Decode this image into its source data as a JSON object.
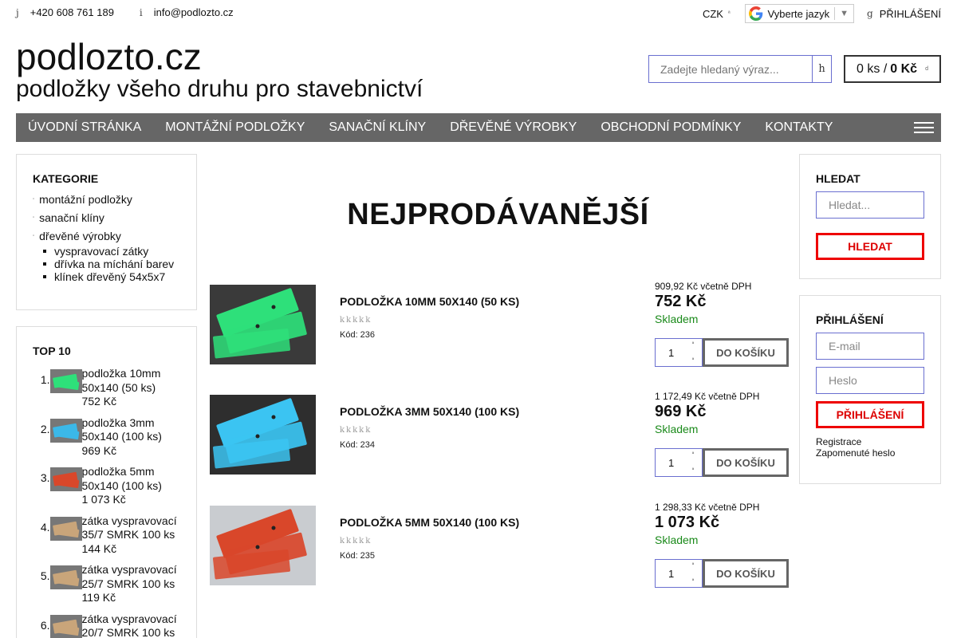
{
  "topbar": {
    "phone_icon": "j",
    "phone": "+420 608 761 189",
    "mail_icon": "i",
    "email": "info@podlozto.cz",
    "currency": "CZK",
    "currency_icon": "ª",
    "language_label": "Vyberte jazyk",
    "language_arrow": "▼",
    "login_icon": "g",
    "login_label": "PŘIHLÁŠENÍ"
  },
  "header": {
    "title": "podlozto.cz",
    "subtitle": "podložky všeho druhu pro stavebnictví",
    "search_placeholder": "Zadejte hledaný výraz...",
    "search_button_icon": "h",
    "cart_count": "0 ks /",
    "cart_total": "0 Kč",
    "cart_icon": "d"
  },
  "nav": {
    "items": [
      "ÚVODNÍ STRÁNKA",
      "MONTÁŽNÍ PODLOŽKY",
      "SANAČNÍ KLÍNY",
      "DŘEVĚNÉ VÝROBKY",
      "OBCHODNÍ PODMÍNKY",
      "KONTAKTY"
    ]
  },
  "categories": {
    "title": "KATEGORIE",
    "bullet": "▫",
    "items": [
      "montážní podložky",
      "sanační klíny",
      "dřevěné výrobky"
    ],
    "subitems": [
      "vyspravovací zátky",
      "dřívka na míchání barev",
      "klínek dřevěný 54x5x7"
    ]
  },
  "top10": {
    "title": "TOP 10",
    "items": [
      {
        "num": "1.",
        "text": "podložka 10mm 50x140 (50 ks)",
        "price": "752 Kč",
        "color": "#2ee07a"
      },
      {
        "num": "2.",
        "text": "podložka 3mm 50x140 (100 ks)",
        "price": "969 Kč",
        "color": "#3bb8e8"
      },
      {
        "num": "3.",
        "text": "podložka 5mm 50x140 (100 ks)",
        "price": "1 073 Kč",
        "color": "#d9472a"
      },
      {
        "num": "4.",
        "text": "zátka vyspravovací 35/7 SMRK 100 ks",
        "price": "144 Kč",
        "color": "#c9a57a"
      },
      {
        "num": "5.",
        "text": "zátka vyspravovací 25/7 SMRK 100 ks",
        "price": "119 Kč",
        "color": "#c9a57a"
      },
      {
        "num": "6.",
        "text": "zátka vyspravovací 20/7 SMRK 100 ks",
        "price": "",
        "color": "#c9a57a"
      }
    ]
  },
  "main": {
    "heading": "NEJPRODÁVANĚJŠÍ",
    "products": [
      {
        "name": "PODLOŽKA 10MM 50X140 (50 KS)",
        "stars": "kkkkk",
        "code": "Kód: 236",
        "price_vat": "909,92 Kč včetně DPH",
        "price": "752 Kč",
        "stock": "Skladem",
        "qty": "1",
        "button": "DO KOŠÍKU",
        "color": "#2ee07a",
        "bg": "#3a3a3a"
      },
      {
        "name": "PODLOŽKA 3MM 50X140 (100 KS)",
        "stars": "kkkkk",
        "code": "Kód: 234",
        "price_vat": "1 172,49 Kč včetně DPH",
        "price": "969 Kč",
        "stock": "Skladem",
        "qty": "1",
        "button": "DO KOŠÍKU",
        "color": "#3bc4f2",
        "bg": "#2e2e2e"
      },
      {
        "name": "PODLOŽKA 5MM 50X140 (100 KS)",
        "stars": "kkkkk",
        "code": "Kód: 235",
        "price_vat": "1 298,33 Kč včetně DPH",
        "price": "1 073 Kč",
        "stock": "Skladem",
        "qty": "1",
        "button": "DO KOŠÍKU",
        "color": "#d9472a",
        "bg": "#c9ccd0"
      }
    ],
    "qty_up": "ª",
    "qty_down": "ª"
  },
  "search_box": {
    "title": "HLEDAT",
    "placeholder": "Hledat...",
    "button": "HLEDAT"
  },
  "login_box": {
    "title": "PŘIHLÁŠENÍ",
    "email_placeholder": "E-mail",
    "password_placeholder": "Heslo",
    "button": "PŘIHLÁŠENÍ",
    "register": "Registrace",
    "forgot": "Zapomenuté heslo"
  }
}
